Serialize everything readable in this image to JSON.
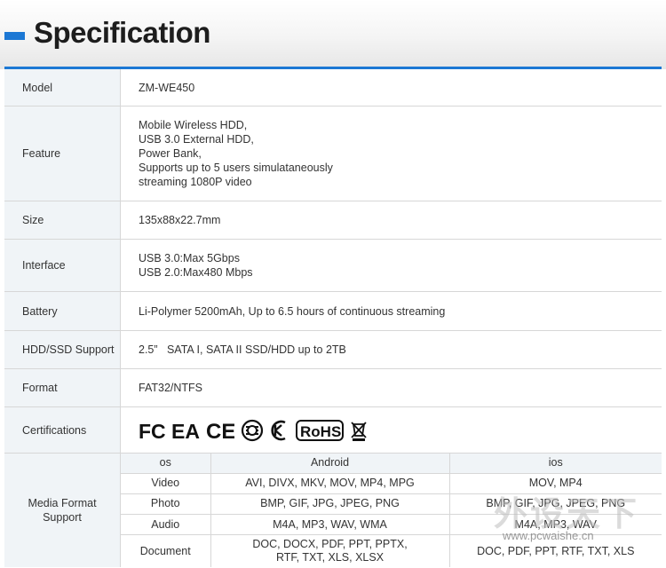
{
  "header": {
    "title": "Specification"
  },
  "specs": {
    "model": {
      "label": "Model",
      "value": "ZM-WE450"
    },
    "feature": {
      "label": "Feature",
      "lines": [
        "Mobile Wireless HDD,",
        "USB 3.0 External HDD,",
        "Power Bank,",
        "Supports up to 5 users simulataneously",
        "streaming 1080P video"
      ]
    },
    "size": {
      "label": "Size",
      "value": "135x88x22.7mm"
    },
    "interface": {
      "label": "Interface",
      "lines": [
        "USB 3.0:Max 5Gbps",
        "USB 2.0:Max480 Mbps"
      ]
    },
    "battery": {
      "label": "Battery",
      "value": "Li-Polymer 5200mAh, Up to 6.5 hours of continuous streaming"
    },
    "storage": {
      "label": "HDD/SSD Support",
      "value": "2.5”   SATA I, SATA II SSD/HDD up to 2TB"
    },
    "format": {
      "label": "Format",
      "value": "FAT32/NTFS"
    },
    "certifications": {
      "label": "Certifications",
      "marks": [
        "FC",
        "EAC",
        "CE",
        "RoHS"
      ],
      "icons": [
        "fcc-logo-icon",
        "eac-logo-icon",
        "ce-logo-icon",
        "safety-mark-icon",
        "kc-mark-icon",
        "rohs-logo-icon",
        "weee-bin-icon"
      ]
    }
  },
  "media": {
    "label_line1": "Media Format",
    "label_line2": "Support",
    "headers": [
      "os",
      "Android",
      "ios"
    ],
    "rows": [
      {
        "kind": "Video",
        "android": [
          "AVI, DIVX, MKV, MOV, MP4, MPG"
        ],
        "ios": [
          "MOV, MP4"
        ]
      },
      {
        "kind": "Photo",
        "android": [
          "BMP, GIF, JPG, JPEG, PNG"
        ],
        "ios": [
          "BMP, GIF, JPG, JPEG, PNG"
        ]
      },
      {
        "kind": "Audio",
        "android": [
          "M4A, MP3, WAV, WMA"
        ],
        "ios": [
          "M4A, MP3, WAV"
        ]
      },
      {
        "kind": "Document",
        "android": [
          "DOC, DOCX, PDF, PPT, PPTX,",
          "RTF, TXT, XLS, XLSX"
        ],
        "ios": [
          "DOC, PDF, PPT, RTF, TXT, XLS"
        ]
      }
    ]
  },
  "watermark": {
    "text": "外设天下",
    "url": "www.pcwaishe.cn"
  }
}
